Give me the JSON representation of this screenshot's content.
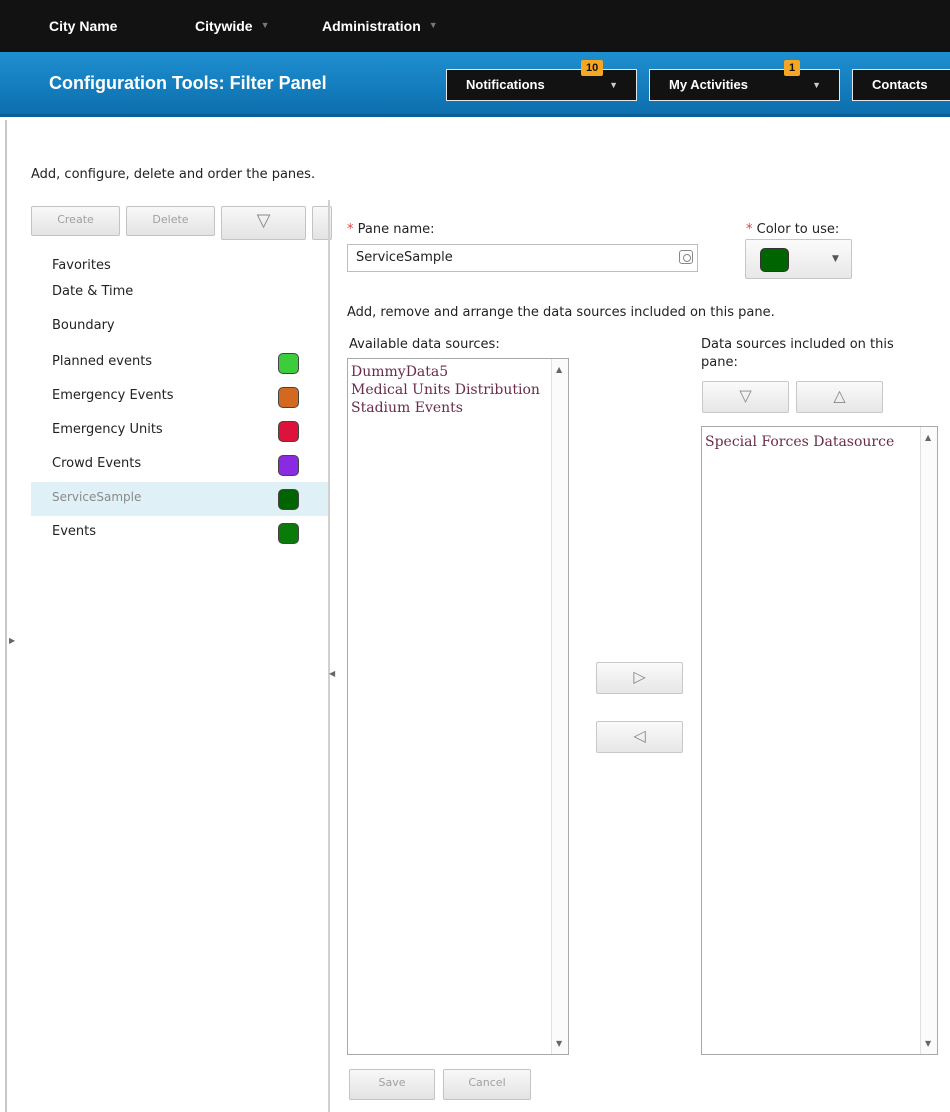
{
  "topnav": {
    "app_name": "City Name",
    "menus": [
      {
        "label": "Citywide"
      },
      {
        "label": "Administration"
      }
    ]
  },
  "header": {
    "title": "Configuration Tools: Filter Panel",
    "notifications": {
      "label": "Notifications",
      "count": "10"
    },
    "activities": {
      "label": "My Activities",
      "count": "1"
    },
    "contacts": {
      "label": "Contacts"
    }
  },
  "intro": "Add, configure, delete and order the panes.",
  "toolbar": {
    "create_label": "Create",
    "delete_label": "Delete",
    "move_down_glyph": "▽"
  },
  "panes": [
    {
      "name": "Favorites",
      "color": null
    },
    {
      "name": "Date & Time",
      "color": null
    },
    {
      "name": "Boundary",
      "color": null
    },
    {
      "name": "Planned events",
      "color": "#3ccc3c"
    },
    {
      "name": "Emergency Events",
      "color": "#d2691e"
    },
    {
      "name": "Emergency Units",
      "color": "#dc143c"
    },
    {
      "name": "Crowd Events",
      "color": "#8a2be2"
    },
    {
      "name": "ServiceSample",
      "color": "#006400",
      "selected": true
    },
    {
      "name": "Events",
      "color": "#0a7a0a"
    }
  ],
  "form": {
    "required_mark": "*",
    "pane_name_label": "Pane name:",
    "pane_name_value": "ServiceSample",
    "color_label": "Color to use:",
    "color_value": "#006400",
    "sources_instruction": "Add, remove and arrange the data sources included on this pane.",
    "available_label": "Available data sources:",
    "included_label_line1": "Data sources included on this",
    "included_label_line2": "pane:",
    "available_sources": [
      "DummyData5",
      "Medical Units Distribution",
      "Stadium Events"
    ],
    "included_sources": [
      "Special Forces Datasource"
    ],
    "add_glyph": "▷",
    "remove_glyph": "◁",
    "move_down_glyph": "▽",
    "move_up_glyph": "△",
    "save_label": "Save",
    "cancel_label": "Cancel"
  }
}
